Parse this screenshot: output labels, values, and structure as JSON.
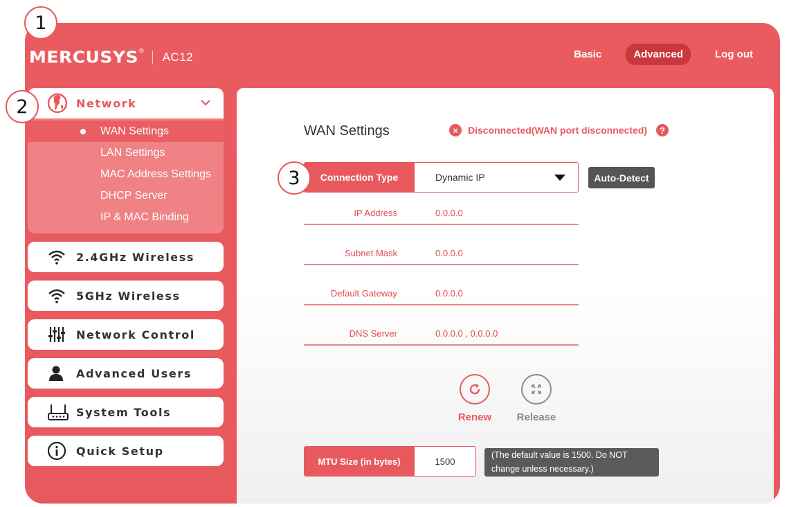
{
  "header": {
    "brand": "MERCUSYS",
    "brand_mark": "®",
    "model": "AC12",
    "nav": [
      "Basic",
      "Advanced",
      "Log out"
    ],
    "active_nav": "Advanced"
  },
  "sidebar": {
    "network": {
      "label": "Network",
      "icon": "globe-icon",
      "expanded": true,
      "submenu": [
        "WAN Settings",
        "LAN Settings",
        "MAC Address Settings",
        "DHCP Server",
        "IP & MAC Binding"
      ],
      "active": "WAN Settings"
    },
    "items": [
      {
        "label": "2.4GHz Wireless",
        "icon": "wifi-icon"
      },
      {
        "label": "5GHz Wireless",
        "icon": "wifi-icon"
      },
      {
        "label": "Network Control",
        "icon": "sliders-icon"
      },
      {
        "label": "Advanced Users",
        "icon": "user-icon"
      },
      {
        "label": "System Tools",
        "icon": "router-icon"
      },
      {
        "label": "Quick Setup",
        "icon": "info-icon"
      }
    ]
  },
  "main": {
    "title": "WAN Settings",
    "status": "Disconnected(WAN port disconnected)",
    "connection_type_label": "Connection Type",
    "connection_type_value": "Dynamic IP",
    "auto_detect": "Auto-Detect",
    "fields": [
      {
        "label": "IP Address",
        "value": "0.0.0.0"
      },
      {
        "label": "Subnet Mask",
        "value": "0.0.0.0"
      },
      {
        "label": "Default Gateway",
        "value": "0.0.0.0"
      },
      {
        "label": "DNS Server",
        "value": "0.0.0.0 , 0.0.0.0"
      }
    ],
    "renew_label": "Renew",
    "release_label": "Release",
    "mtu_label": "MTU Size (in bytes)",
    "mtu_value": "1500",
    "mtu_note": "(The default value is 1500. Do NOT change unless necessary.)"
  },
  "steps": [
    "1",
    "2",
    "3"
  ],
  "colors": {
    "accent": "#e8595e",
    "active_nav_bg": "#c8383d",
    "submenu_bg": "#f08185",
    "dark_button": "#555555",
    "release_gray": "#8a8a8a"
  }
}
